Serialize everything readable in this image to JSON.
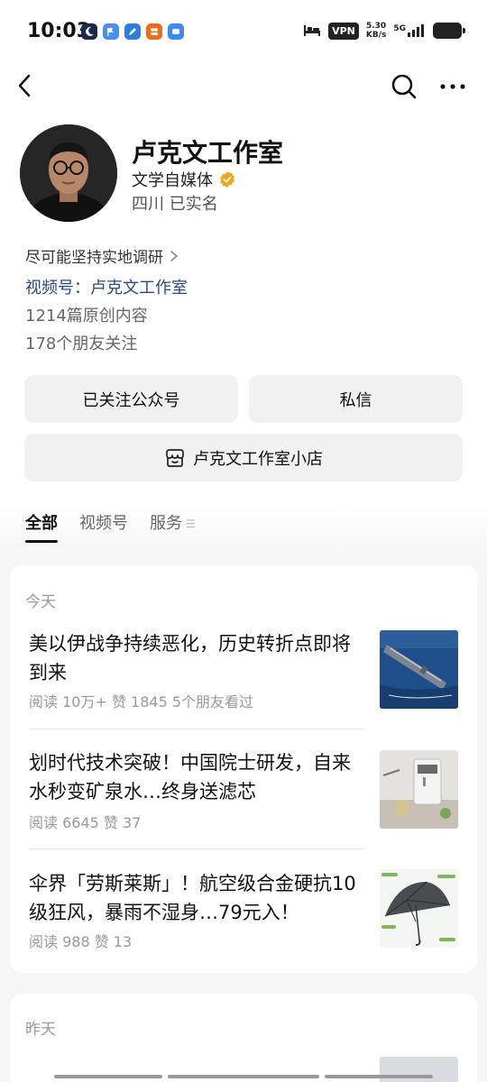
{
  "status_bar": {
    "time": "10:03",
    "vpn": "VPN",
    "speed_value": "5.30",
    "speed_unit": "KB/s",
    "network": "5G"
  },
  "nav": {
    "back_icon": "chevron-left-icon",
    "search_icon": "search-icon",
    "more_icon": "more-dots-icon"
  },
  "profile": {
    "name": "卢克文工作室",
    "verify_label": "文学自媒体",
    "location": "四川 已实名",
    "bio": "尽可能坚持实地调研",
    "channel": "视频号：卢克文工作室",
    "original_count": "1214篇原创内容",
    "followers": "178个朋友关注",
    "verified_color": "#f0a51e"
  },
  "actions": {
    "follow": "已关注公众号",
    "message": "私信",
    "shop": "卢克文工作室小店"
  },
  "tabs": [
    {
      "label": "全部",
      "active": true
    },
    {
      "label": "视频号",
      "active": false
    },
    {
      "label": "服务",
      "active": false
    }
  ],
  "feed": {
    "today_label": "今天",
    "yesterday_label": "昨天",
    "articles": [
      {
        "title": "美以伊战争持续恶化，历史转折点即将到来",
        "meta": "阅读 10万+   赞 1845   5个朋友看过"
      },
      {
        "title": "划时代技术突破！中国院士研发，自来水秒变矿泉水…终身送滤芯",
        "meta": "阅读 6645   赞 37"
      },
      {
        "title": "伞界「劳斯莱斯」！航空级合金硬抗10级狂风，暴雨不湿身…79元入！",
        "meta": "阅读 988   赞 13"
      }
    ]
  }
}
